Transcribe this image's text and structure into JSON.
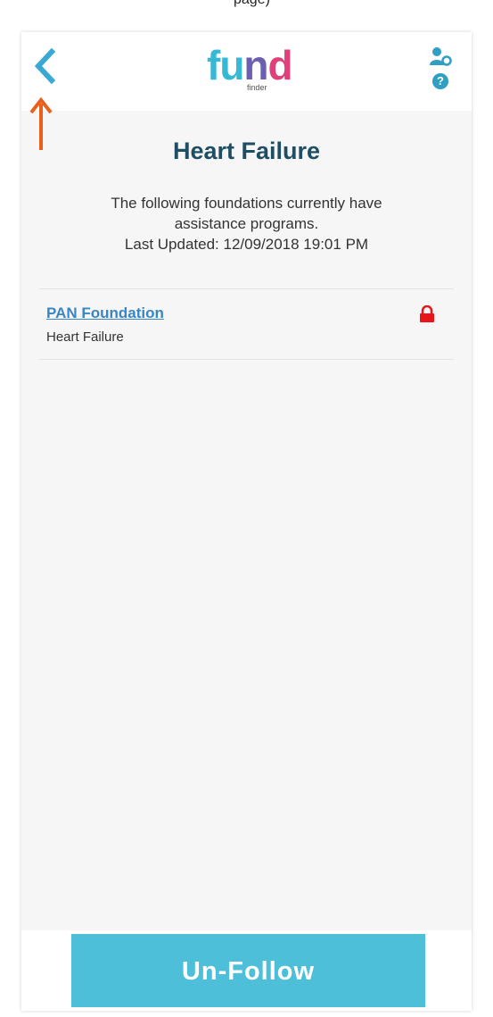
{
  "top_strip": {
    "text": "page)"
  },
  "header": {
    "logo_fund": "fund",
    "logo_sub": "finder",
    "back_icon": "chevron-left-icon",
    "user_icon": "user-settings-icon",
    "help_icon": "help-icon",
    "help_glyph": "?"
  },
  "main": {
    "title": "Heart Failure",
    "intro_line1": "The following foundations currently have",
    "intro_line2": "assistance programs.",
    "intro_line3": "Last Updated: 12/09/2018 19:01 PM",
    "foundations": [
      {
        "name": "PAN Foundation",
        "subtitle": "Heart Failure",
        "lock_icon": "lock-icon"
      }
    ]
  },
  "footer": {
    "unfollow_label": "Un-Follow"
  },
  "colors": {
    "accent": "#4dbfd8",
    "title": "#1f4d63",
    "link": "#3a86c4",
    "lock": "#e8151b",
    "annotation": "#e8601c"
  },
  "annotation": {
    "icon": "arrow-up-icon"
  }
}
